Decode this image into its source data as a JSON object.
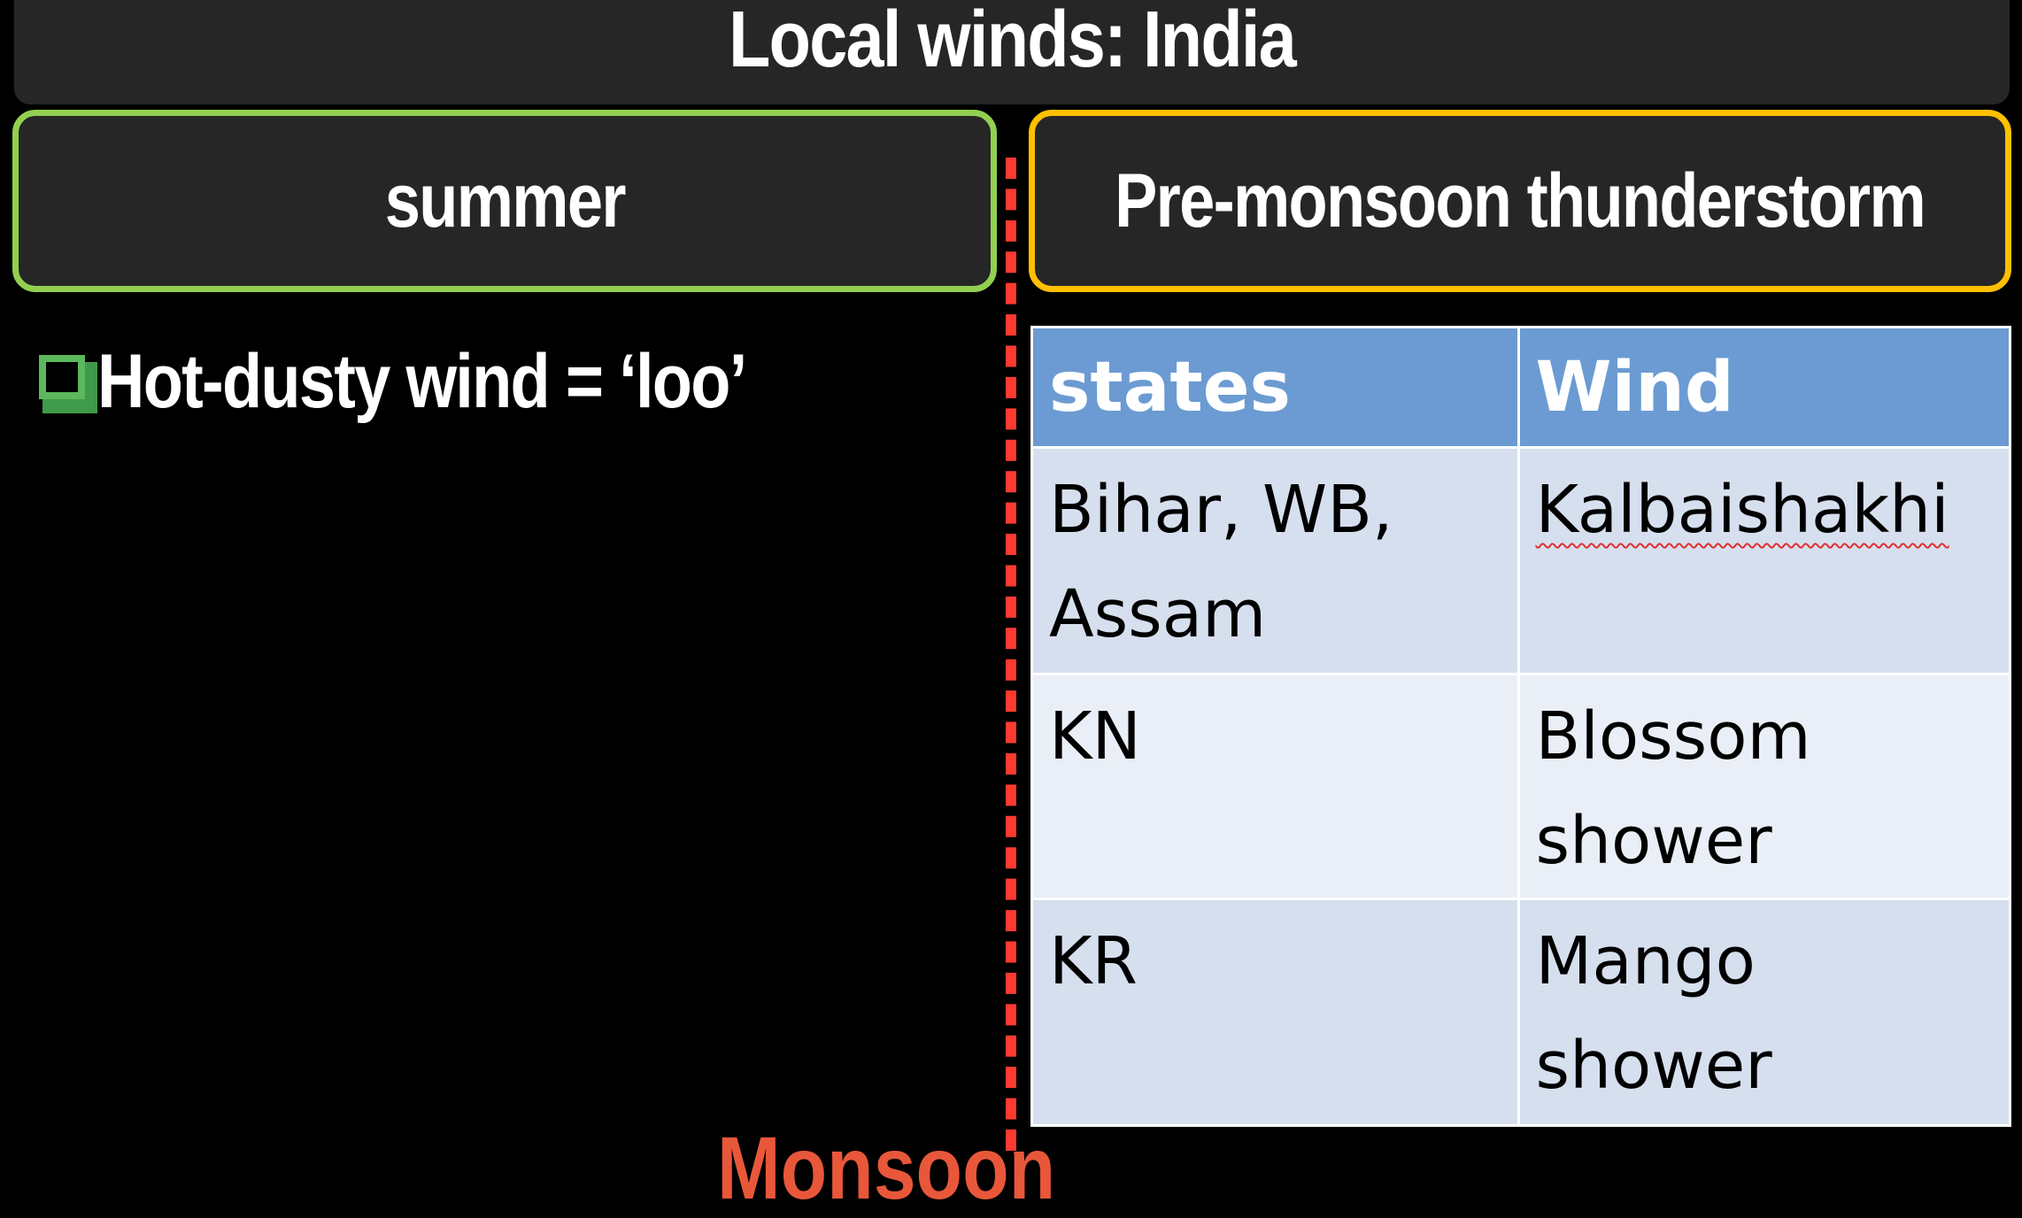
{
  "title": "Local winds: India",
  "left_box": {
    "label": "summer",
    "border_color": "#92d050"
  },
  "right_box": {
    "label": "Pre-monsoon thunderstorm",
    "border_color": "#ffc000"
  },
  "bullet": {
    "icon": "hollow-square-bullet-icon",
    "text": "Hot-dusty wind = ‘loo’"
  },
  "table": {
    "headers": [
      "states",
      "Wind"
    ],
    "header_color": "#6b9bd2",
    "rows": [
      {
        "states_line1": "Bihar, WB,",
        "states_line2": "Assam",
        "wind_line1": "Kalbaishakhi",
        "wind_line2": ""
      },
      {
        "states_line1": "KN",
        "states_line2": "",
        "wind_line1": "Blossom",
        "wind_line2": "shower"
      },
      {
        "states_line1": "KR",
        "states_line2": "",
        "wind_line1": "Mango",
        "wind_line2": "shower"
      }
    ]
  },
  "footer_partial_text": "Monsoon",
  "divider_color": "#ff3b30"
}
